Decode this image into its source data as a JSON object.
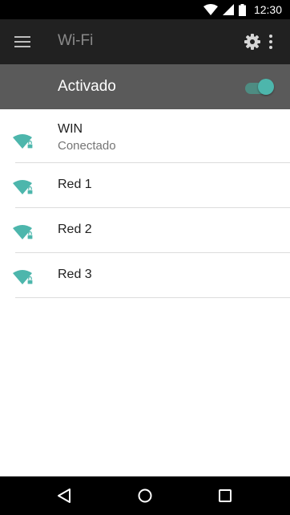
{
  "status_bar": {
    "time": "12:30",
    "icons": [
      "wifi-icon",
      "cellular-signal-icon",
      "battery-icon"
    ]
  },
  "app_bar": {
    "title": "Wi-Fi",
    "icons": [
      "menu-icon",
      "settings-gear-icon",
      "more-vert-icon"
    ]
  },
  "master_switch": {
    "label": "Activado",
    "on": true
  },
  "networks": [
    {
      "name": "WIN",
      "status": "Conectado",
      "secured": true
    },
    {
      "name": "Red 1",
      "secured": true
    },
    {
      "name": "Red 2",
      "secured": true
    },
    {
      "name": "Red 3",
      "secured": true
    }
  ],
  "nav_bar": {
    "icons": [
      "back-icon",
      "home-icon",
      "recents-icon"
    ]
  },
  "colors": {
    "accent": "#4db6ac",
    "app_bar": "#212121",
    "switch_row": "#5a5a5a",
    "status_bar": "#000000"
  }
}
